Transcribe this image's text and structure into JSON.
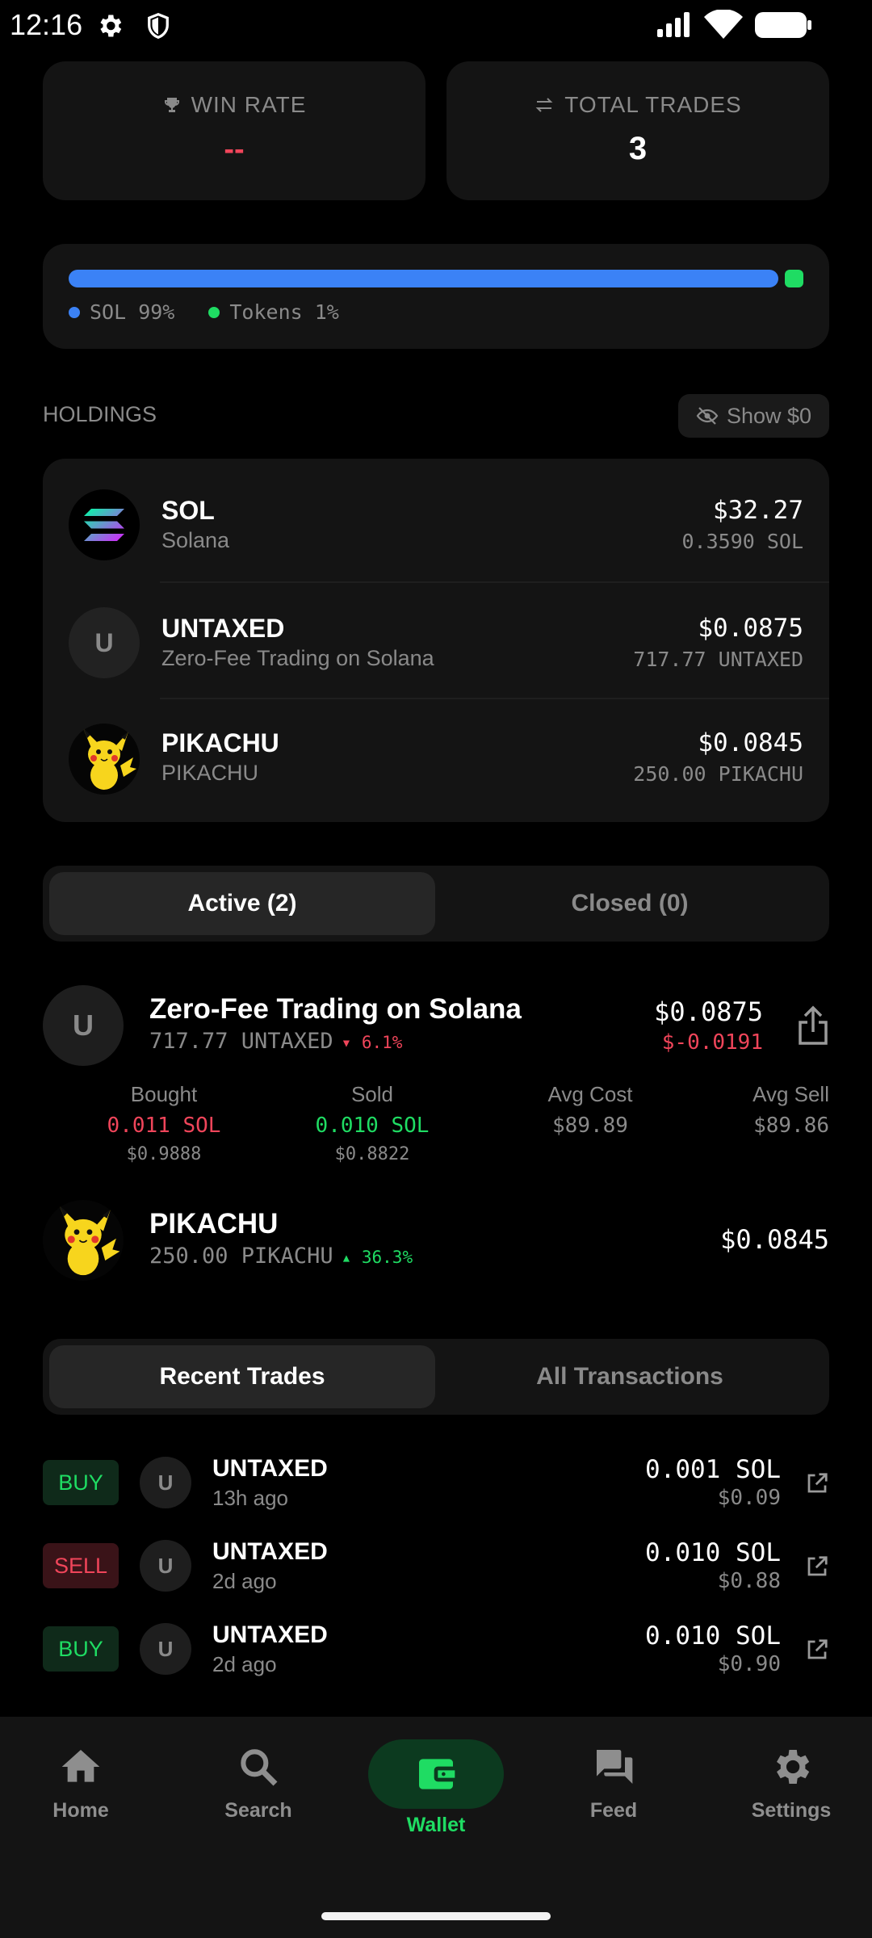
{
  "status_bar": {
    "time": "12:16"
  },
  "stats": {
    "win_rate": {
      "label": "WIN RATE",
      "value": "--"
    },
    "total_trades": {
      "label": "TOTAL TRADES",
      "value": "3"
    }
  },
  "allocation": {
    "sol_fraction": 0.99,
    "tokens_fraction": 0.01,
    "sol_label": "SOL 99%",
    "tokens_label": "Tokens 1%",
    "colors": {
      "sol": "#3b82f6",
      "tokens": "#1fdc63"
    }
  },
  "holdings": {
    "title": "HOLDINGS",
    "show_zero_label": "Show $0",
    "items": [
      {
        "symbol": "SOL",
        "name": "Solana",
        "value": "$32.27",
        "amount": "0.3590 SOL",
        "icon": "solana-logo-icon"
      },
      {
        "symbol": "UNTAXED",
        "name": "Zero-Fee Trading on Solana",
        "value": "$0.0875",
        "amount": "717.77 UNTAXED",
        "icon_letter": "U"
      },
      {
        "symbol": "PIKACHU",
        "name": "PIKACHU",
        "value": "$0.0845",
        "amount": "250.00 PIKACHU",
        "icon": "pikachu-avatar-icon"
      }
    ]
  },
  "positions_tabs": {
    "active": "Active (2)",
    "closed": "Closed (0)"
  },
  "positions": [
    {
      "icon_letter": "U",
      "name": "Zero-Fee Trading on Solana",
      "amount": "717.77 UNTAXED",
      "change": "6.1%",
      "value": "$0.0875",
      "pnl": "$-0.0191",
      "stats": {
        "bought_label": "Bought",
        "bought_sol": "0.011 SOL",
        "bought_usd": "$0.9888",
        "sold_label": "Sold",
        "sold_sol": "0.010 SOL",
        "sold_usd": "$0.8822",
        "avg_cost_label": "Avg Cost",
        "avg_cost": "$89.89",
        "avg_sell_label": "Avg Sell",
        "avg_sell": "$89.86"
      }
    },
    {
      "name": "PIKACHU",
      "amount": "250.00 PIKACHU",
      "change": "36.3%",
      "value": "$0.0845"
    }
  ],
  "trades_tabs": {
    "recent": "Recent Trades",
    "all": "All Transactions"
  },
  "trades": [
    {
      "side": "BUY",
      "icon_letter": "U",
      "token": "UNTAXED",
      "time": "13h ago",
      "sol": "0.001 SOL",
      "usd": "$0.09"
    },
    {
      "side": "SELL",
      "icon_letter": "U",
      "token": "UNTAXED",
      "time": "2d ago",
      "sol": "0.010 SOL",
      "usd": "$0.88"
    },
    {
      "side": "BUY",
      "icon_letter": "U",
      "token": "UNTAXED",
      "time": "2d ago",
      "sol": "0.010 SOL",
      "usd": "$0.90"
    }
  ],
  "nav": {
    "home": "Home",
    "search": "Search",
    "wallet": "Wallet",
    "feed": "Feed",
    "settings": "Settings",
    "active_color": "#1fdc63"
  }
}
